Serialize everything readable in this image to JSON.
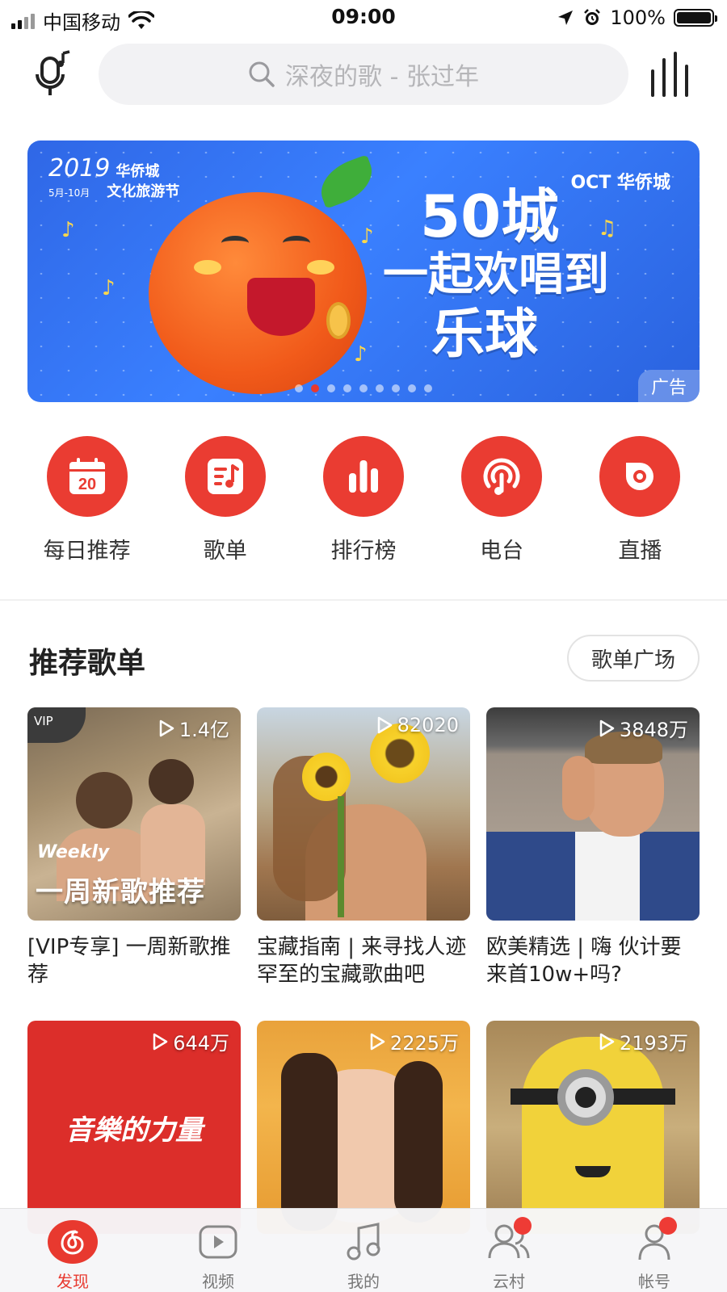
{
  "status_bar": {
    "carrier": "中国移动",
    "time": "09:00",
    "battery": "100%",
    "battery_level": 1.0
  },
  "header": {
    "search_placeholder": "深夜的歌 - 张过年",
    "left_icon": "mic-note-icon",
    "right_icon": "equalizer-icon"
  },
  "banner": {
    "logo_year": "2019",
    "logo_line1": "华侨城",
    "logo_line2": "文化旅游节",
    "logo_dates": "5月-10月",
    "brand": "OCT 华侨城",
    "headline_1": "50城",
    "headline_2": "一起欢唱到",
    "headline_3": "乐球",
    "ad_tag": "广告",
    "dot_count": 9,
    "active_dot": 1,
    "colors": {
      "background": "#3a80ff",
      "accent": "#e8392f"
    }
  },
  "shortcuts": [
    {
      "label": "每日推荐",
      "icon": "calendar-icon",
      "day": "20"
    },
    {
      "label": "歌单",
      "icon": "playlist-icon"
    },
    {
      "label": "排行榜",
      "icon": "chart-icon"
    },
    {
      "label": "电台",
      "icon": "radio-icon"
    },
    {
      "label": "直播",
      "icon": "live-icon"
    }
  ],
  "section": {
    "title": "推荐歌单",
    "more_button": "歌单广场"
  },
  "playlists": [
    {
      "title": "[VIP专享] 一周新歌推荐",
      "plays": "1.4亿",
      "badge": "VIP",
      "cover_text_small": "Weekly",
      "cover_text_big": "一周新歌推荐"
    },
    {
      "title": "宝藏指南 | 来寻找人迹罕至的宝藏歌曲吧",
      "plays": "82020"
    },
    {
      "title": "欧美精选 | 嗨 伙计要来首10w+吗?",
      "plays": "3848万"
    },
    {
      "title": "",
      "plays": "644万",
      "cover_text": "音樂的力量"
    },
    {
      "title": "",
      "plays": "2225万"
    },
    {
      "title": "",
      "plays": "2193万"
    }
  ],
  "tabbar": [
    {
      "label": "发现",
      "icon": "netease-logo-icon",
      "active": true,
      "dot": false
    },
    {
      "label": "视频",
      "icon": "video-play-icon",
      "active": false,
      "dot": false
    },
    {
      "label": "我的",
      "icon": "music-note-icon",
      "active": false,
      "dot": false
    },
    {
      "label": "云村",
      "icon": "friends-icon",
      "active": false,
      "dot": true
    },
    {
      "label": "帐号",
      "icon": "user-icon",
      "active": false,
      "dot": true
    }
  ]
}
